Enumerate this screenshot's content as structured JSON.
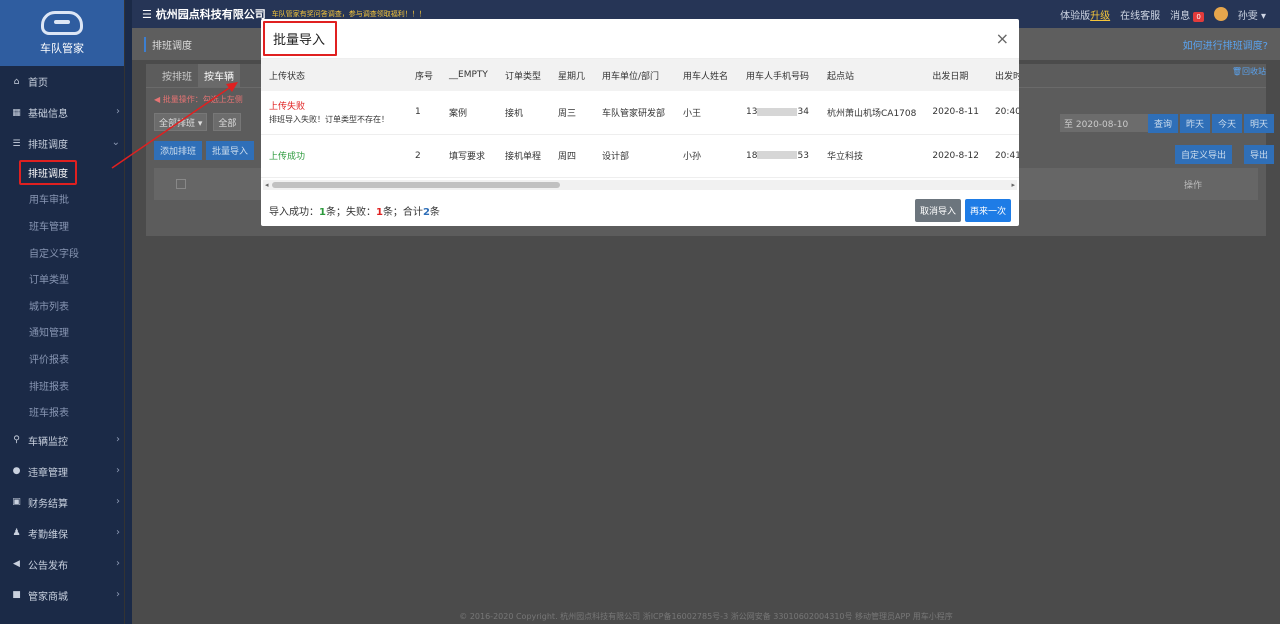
{
  "sidebar": {
    "brand": "车队管家",
    "menu": [
      {
        "label": "首页",
        "icon": "home-icon"
      },
      {
        "label": "基础信息",
        "icon": "building-icon"
      },
      {
        "label": "排班调度",
        "icon": "sliders-icon"
      }
    ],
    "submenu": [
      "排班调度",
      "用车审批",
      "班车管理",
      "自定义字段",
      "订单类型",
      "城市列表",
      "通知管理",
      "评价报表",
      "排班报表",
      "班车报表"
    ],
    "menu_bottom": [
      {
        "label": "车辆监控",
        "icon": "location-icon"
      },
      {
        "label": "违章管理",
        "icon": "warning-icon"
      },
      {
        "label": "财务结算",
        "icon": "finance-icon"
      },
      {
        "label": "考勤维保",
        "icon": "users-icon"
      },
      {
        "label": "公告发布",
        "icon": "megaphone-icon"
      },
      {
        "label": "管家商城",
        "icon": "shop-icon"
      }
    ]
  },
  "topbar": {
    "company": "杭州园点科技有限公司",
    "notice": "车队管家有奖问答调查，参与调查领取福利！！！",
    "trial": "体验版",
    "upgrade": "升级",
    "service": "在线客服",
    "messages": "消息",
    "msg_count": "0",
    "user": "孙雯"
  },
  "page": {
    "crumb": "排班调度",
    "help": "如何进行排班调度?",
    "tabs": [
      "按排班",
      "按车辆"
    ],
    "tip": "批量操作：勾选上左侧",
    "filter1": "全部排班",
    "filter2": "全部",
    "date_to": "至",
    "date_val": "2020-08-10",
    "quick": [
      "查询",
      "昨天",
      "今天",
      "明天"
    ],
    "add": "添加排班",
    "batch": "批量导入",
    "custom_export": "自定义导出",
    "export": "导出",
    "ops": "操作",
    "recycle": "回收站",
    "footer": "© 2016-2020 Copyright. 杭州园点科技有限公司 浙ICP备16002785号-3 浙公网安备 33010602004310号 移动管理员APP 用车小程序"
  },
  "modal": {
    "title": "批量导入",
    "columns": [
      "上传状态",
      "序号",
      "__EMPTY",
      "订单类型",
      "星期几",
      "用车单位/部门",
      "用车人姓名",
      "用车人手机号码",
      "起点站",
      "出发日期",
      "出发时"
    ],
    "rows": [
      {
        "status": "上传失败",
        "msg": "排班导入失败！订单类型不存在！",
        "no": "1",
        "empty": "案例",
        "type": "接机",
        "weekday": "周三",
        "dept": "车队管家研发部",
        "name": "小王",
        "phone_a": "13",
        "phone_b": "34",
        "start": "杭州萧山机场CA1708",
        "date": "2020-8-11",
        "time": "20:40"
      },
      {
        "status": "上传成功",
        "msg": "",
        "no": "2",
        "empty": "填写要求",
        "type": "接机单程",
        "weekday": "周四",
        "dept": "设计部",
        "name": "小孙",
        "phone_a": "18",
        "phone_b": "53",
        "start": "华立科技",
        "date": "2020-8-12",
        "time": "20:41"
      }
    ],
    "summary_prefix": "导入成功：",
    "success": "1",
    "unit1": "条；失败：",
    "fail": "1",
    "unit2": "条；合计",
    "total": "2",
    "unit3": "条",
    "cancel": "取消导入",
    "again": "再来一次"
  },
  "colors": {
    "accent": "#1e7ce6",
    "danger": "#e02020",
    "success": "#2c9a3c",
    "sidebar": "#1b2a47"
  }
}
